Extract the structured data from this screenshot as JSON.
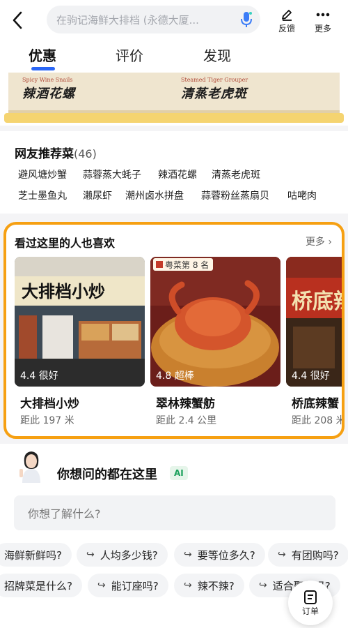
{
  "header": {
    "search_placeholder": "在驹记海鲜大排档 (永德大厦...",
    "feedback_label": "反馈",
    "more_label": "更多",
    "icons": {
      "back": "back-arrow-icon",
      "mic": "voice-mic-icon",
      "feedback": "pencil-icon",
      "more": "three-dots-icon"
    }
  },
  "tabs": [
    {
      "label": "优惠",
      "active": true
    },
    {
      "label": "评价",
      "active": false
    },
    {
      "label": "发现",
      "active": false
    }
  ],
  "banner": {
    "dishes": [
      {
        "en": "Spicy Wine Snails",
        "cn": "辣酒花螺"
      },
      {
        "en": "Steamed Tiger Grouper",
        "cn": "清蒸老虎斑"
      }
    ]
  },
  "recommended": {
    "title": "网友推荐菜",
    "count": "(46)",
    "dishes": [
      "避风塘炒蟹",
      "蒜蓉蒸大蚝子",
      "辣酒花螺",
      "清蒸老虎斑",
      "芝士墨鱼丸",
      "濑尿虾",
      "潮州卤水拼盘",
      "蒜蓉粉丝蒸扇贝",
      "咕咾肉"
    ]
  },
  "also_liked": {
    "title": "看过这里的人也喜欢",
    "more": "更多",
    "shops": [
      {
        "name": "大排档小炒",
        "rating": "4.4 很好",
        "distance": "距此 197 米",
        "badge": ""
      },
      {
        "name": "翠林辣蟹舫",
        "rating": "4.8 超棒",
        "distance": "距此 2.4 公里",
        "badge": "粤菜第 8 名"
      },
      {
        "name": "桥底辣蟹",
        "rating": "4.4 很好",
        "distance": "距此 208 米",
        "badge": ""
      }
    ]
  },
  "ai_section": {
    "title": "你想问的都在这里",
    "badge": "AI",
    "input_placeholder": "你想了解什么?",
    "chips_row1": [
      "海鲜新鲜吗?",
      "人均多少钱?",
      "要等位多久?",
      "有团购吗?"
    ],
    "chips_row2": [
      "招牌菜是什么?",
      "能订座吗?",
      "辣不辣?",
      "适合聚餐吗?"
    ]
  },
  "order_button": {
    "label": "订单"
  },
  "colors": {
    "accent": "#2a66f6",
    "highlight_border": "#f6a012",
    "ai_green": "#19a05a"
  }
}
